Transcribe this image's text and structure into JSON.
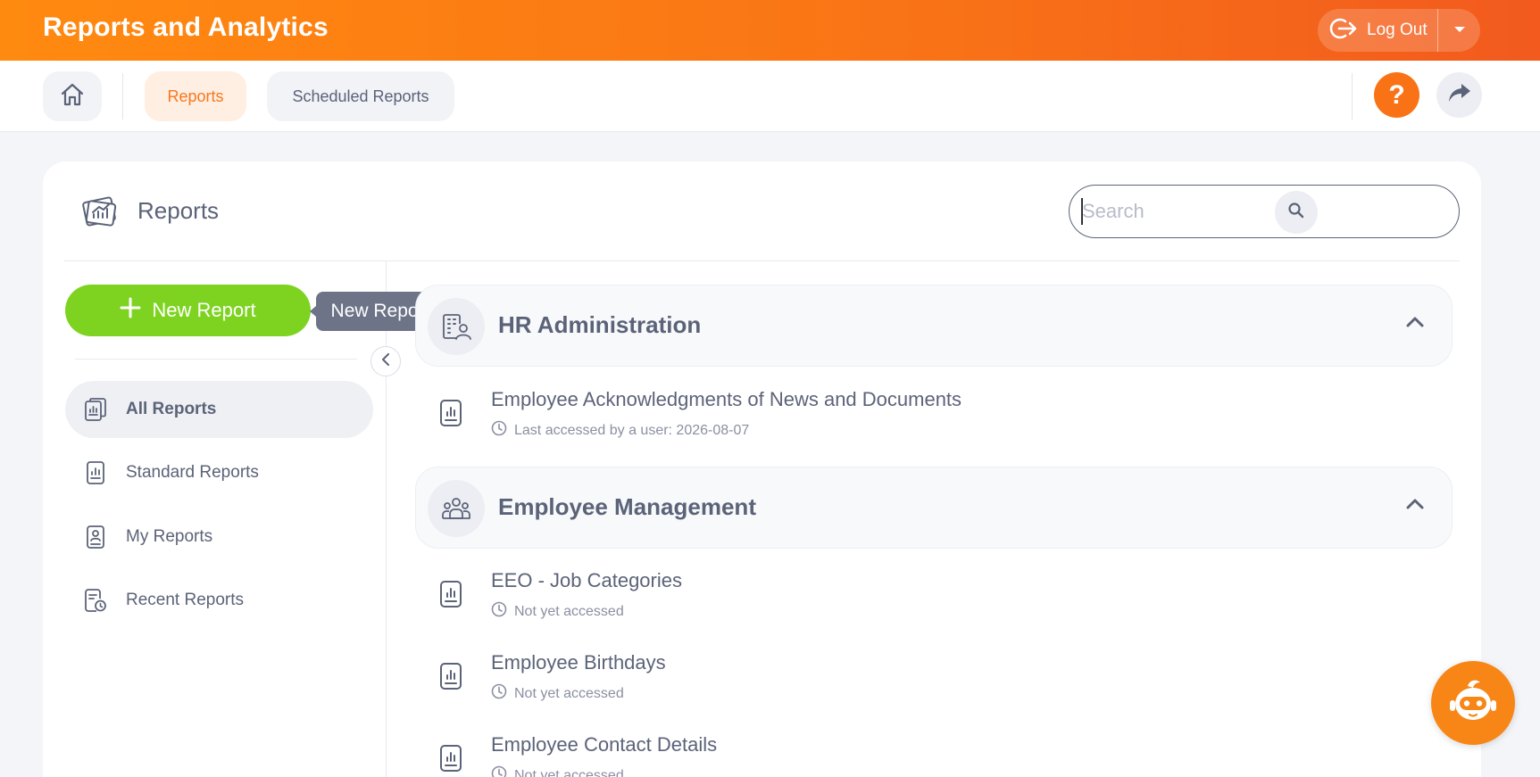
{
  "header": {
    "app_title": "Reports and Analytics",
    "logout_label": "Log Out"
  },
  "subnav": {
    "tabs": [
      {
        "label": "Reports",
        "active": true
      },
      {
        "label": "Scheduled Reports",
        "active": false
      }
    ],
    "help_symbol": "?"
  },
  "panel": {
    "title": "Reports",
    "search_placeholder": "Search"
  },
  "sidebar": {
    "new_report_label": "New Report",
    "tooltip": "New Report",
    "items": [
      {
        "label": "All Reports",
        "icon": "all-reports-icon",
        "active": true
      },
      {
        "label": "Standard Reports",
        "icon": "standard-reports-icon",
        "active": false
      },
      {
        "label": "My Reports",
        "icon": "my-reports-icon",
        "active": false
      },
      {
        "label": "Recent Reports",
        "icon": "recent-reports-icon",
        "active": false
      }
    ]
  },
  "groups": [
    {
      "title": "HR Administration",
      "icon": "building-user-icon",
      "reports": [
        {
          "name": "Employee Acknowledgments of News and Documents",
          "meta": "Last accessed by a user: 2026-08-07"
        }
      ]
    },
    {
      "title": "Employee Management",
      "icon": "people-group-icon",
      "reports": [
        {
          "name": "EEO - Job Categories",
          "meta": "Not yet accessed"
        },
        {
          "name": "Employee Birthdays",
          "meta": "Not yet accessed"
        },
        {
          "name": "Employee Contact Details",
          "meta": "Not yet accessed"
        }
      ]
    }
  ],
  "colors": {
    "brand_orange": "#f97316",
    "new_report_green": "#7ed321",
    "text": "#5b6378"
  }
}
